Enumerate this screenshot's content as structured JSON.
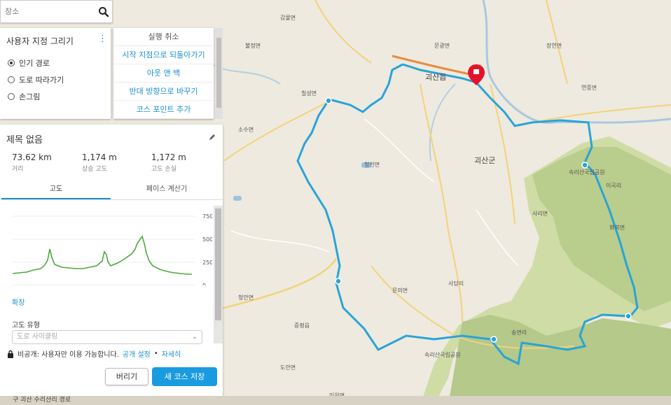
{
  "search": {
    "placeholder": "장소"
  },
  "draw_panel": {
    "title": "사용자 지정 그리기",
    "options": [
      {
        "label": "인기 경로",
        "selected": true
      },
      {
        "label": "도로 따라가기",
        "selected": false
      },
      {
        "label": "손그림",
        "selected": false
      }
    ]
  },
  "menu": {
    "items": [
      "실행 취소",
      "시작 지점으로 되돌아가기",
      "아웃 앤 백",
      "반대 방향으로 바꾸기",
      "코스 포인트 추가"
    ]
  },
  "course": {
    "title": "제목 없음",
    "stats": [
      {
        "value": "73.62 km",
        "label": "거리"
      },
      {
        "value": "1,174 m",
        "label": "상승 고도"
      },
      {
        "value": "1,172 m",
        "label": "고도 손실"
      }
    ],
    "tabs": [
      "고도",
      "페이스 계산기"
    ],
    "elevation_axis": [
      "750",
      "500",
      "250",
      "0"
    ],
    "expand_label": "확장",
    "elevation_type_label": "고도 유형",
    "elevation_type_value": "도로 사이클링",
    "privacy_text": "비공개: 사용자만 이용 가능합니다.",
    "privacy_link": "공개 설정",
    "more_link": "자세히",
    "discard_label": "버리기",
    "save_label": "새 코스 저장"
  },
  "map": {
    "labels": [
      "괴산읍",
      "괴산군",
      "속리산국립공원",
      "속리산국립공원",
      "청천면",
      "사리면",
      "칠성면",
      "문광면",
      "감물면",
      "장연면",
      "연풍면",
      "불정면",
      "소수면",
      "청안면",
      "증평읍",
      "도안면",
      "미원면",
      "문의면",
      "화북면",
      "송면리",
      "사담리",
      "이곡리"
    ],
    "route_color": "#2aa3d8",
    "marker_color": "#e4132a"
  },
  "bottom_strip_text": "구 괴산 수리산리 경로"
}
